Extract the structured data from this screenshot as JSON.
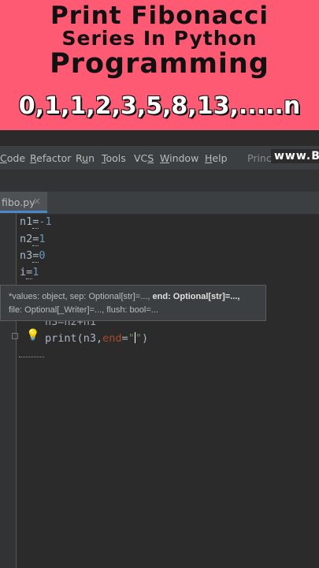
{
  "banner": {
    "title_line1": "Print Fibonacci",
    "title_line2": "Series In Python",
    "title_line3": "Programming",
    "sequence": "0,1,1,2,3,5,8,13,.....n"
  },
  "menu": {
    "items": [
      "Code",
      "Refactor",
      "Run",
      "Tools",
      "VCS",
      "Window",
      "Help"
    ],
    "project": "Princu",
    "brand": "www.B"
  },
  "editor": {
    "tab_label": "fibo.py",
    "tab_close": "×",
    "lines": {
      "l1_var": "n1",
      "l1_op": "=",
      "l1_val": "-1",
      "l2_var": "n2",
      "l2_op": "=",
      "l2_val": "1",
      "l3_var": "n3",
      "l3_op": "=",
      "l3_val": "0",
      "l4_var": "i",
      "l4_op": "=",
      "l4_val": "1",
      "l6_text": "n3=n2+n1",
      "l7_fn": "print(n3,",
      "l7_kw": "end",
      "l7_eq": "=",
      "l7_str": "\"\"",
      "l7_close": ")"
    }
  },
  "hint": {
    "line1_pre": "*values: object, sep: Optional[str]=..., ",
    "line1_bold": "end: Optional[str]=...,",
    "line2": "file: Optional[_Writer]=..., flush: bool=..."
  },
  "colors": {
    "banner_bg": "#ff5a73",
    "editor_bg": "#2b2b2b",
    "number": "#6897bb",
    "string": "#6a8759",
    "keyword_arg": "#aa4926"
  },
  "icons": {
    "bulb": "lightbulb-icon",
    "close": "close-icon"
  }
}
